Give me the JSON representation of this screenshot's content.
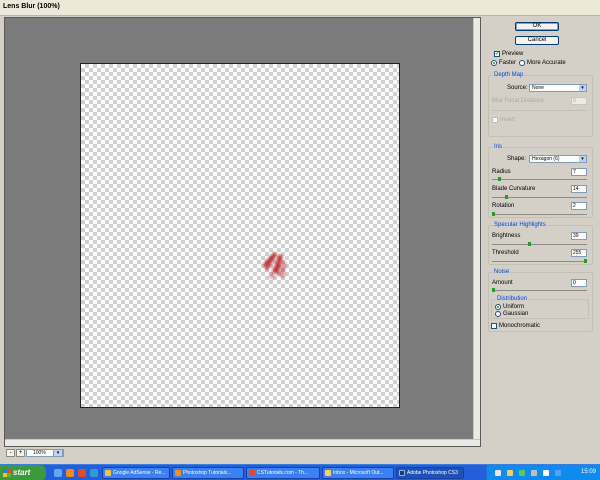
{
  "window": {
    "title": "Lens Blur (100%)"
  },
  "zoom": {
    "value": "100%",
    "minus": "-",
    "plus": "+"
  },
  "buttons": {
    "ok": "OK",
    "cancel": "Cancel"
  },
  "preview": {
    "label": "Preview",
    "faster": "Faster",
    "more_accurate": "More Accurate"
  },
  "depth_map": {
    "title": "Depth Map",
    "source_label": "Source:",
    "source_value": "None",
    "focal_label": "Blur Focal Distance",
    "focal_value": "0",
    "invert_label": "Invert"
  },
  "iris": {
    "title": "Iris",
    "shape_label": "Shape:",
    "shape_value": "Hexagon (6)",
    "radius_label": "Radius",
    "radius_value": "7",
    "blade_label": "Blade Curvature",
    "blade_value": "14",
    "rotation_label": "Rotation",
    "rotation_value": "2"
  },
  "specular": {
    "title": "Specular Highlights",
    "brightness_label": "Brightness",
    "brightness_value": "39",
    "threshold_label": "Threshold",
    "threshold_value": "255"
  },
  "noise": {
    "title": "Noise",
    "amount_label": "Amount",
    "amount_value": "0",
    "distribution_title": "Distribution",
    "uniform": "Uniform",
    "gaussian": "Gaussian",
    "monochromatic": "Monochromatic"
  },
  "taskbar": {
    "start": "start",
    "tasks": [
      "Google AdSense - Re...",
      "Photoshop Tutorials...",
      "CSTutorials.com - Th...",
      "Inbox - Microsoft Out...",
      "Adobe Photoshop CS3"
    ],
    "clock": "15:09"
  },
  "colors": {
    "accent": "#0046d5",
    "slider_thumb": "#21a121",
    "taskbar": "#245edb",
    "start": "#3c9a3c"
  }
}
